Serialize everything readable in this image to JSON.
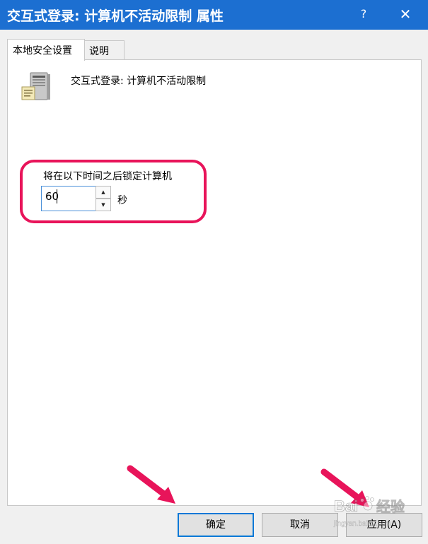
{
  "window": {
    "title": "交互式登录: 计算机不活动限制 属性",
    "help_label": "?",
    "close_label": "✕"
  },
  "tabs": [
    {
      "label": "本地安全设置",
      "active": true
    },
    {
      "label": "说明",
      "active": false
    }
  ],
  "policy": {
    "icon": "server-icon",
    "name": "交互式登录: 计算机不活动限制"
  },
  "setting": {
    "label": "将在以下时间之后锁定计算机",
    "value": "60",
    "unit": "秒",
    "spin_up": "▲",
    "spin_down": "▼"
  },
  "buttons": {
    "ok_label": "确定",
    "cancel_label": "取消",
    "apply_label": "应用(A)"
  },
  "annotations": {
    "highlight_color": "#e8145a",
    "arrow_color": "#e8145a",
    "arrows": [
      "arrow-to-ok-button",
      "arrow-to-apply-button"
    ]
  },
  "watermark": {
    "brand": "Bai",
    "product": "经验",
    "url": "jingyan.baidu.com"
  },
  "colors": {
    "titlebar": "#1c6fd1",
    "focus": "#0078d7"
  }
}
